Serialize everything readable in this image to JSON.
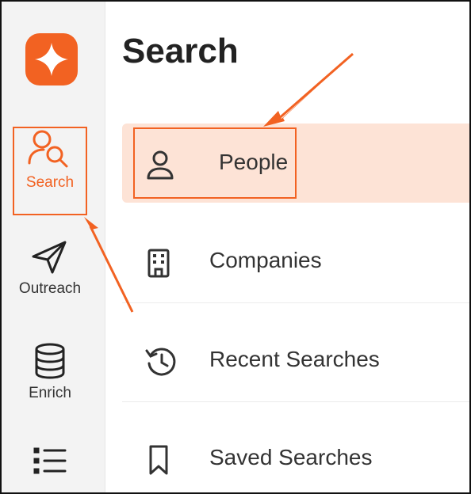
{
  "colors": {
    "accent": "#f26222",
    "active_row_bg": "#fde3d6",
    "sidebar_bg": "#f3f3f3"
  },
  "sidebar": {
    "logo_icon": "brand-logo-icon",
    "items": [
      {
        "label": "Search",
        "icon": "user-search-icon",
        "active": true
      },
      {
        "label": "Outreach",
        "icon": "paper-plane-icon",
        "active": false
      },
      {
        "label": "Enrich",
        "icon": "database-icon",
        "active": false
      },
      {
        "label": "",
        "icon": "list-icon",
        "active": false
      }
    ]
  },
  "main": {
    "title": "Search",
    "menu": [
      {
        "label": "People",
        "icon": "person-icon",
        "active": true
      },
      {
        "label": "Companies",
        "icon": "building-icon",
        "active": false
      },
      {
        "label": "Recent Searches",
        "icon": "history-icon",
        "active": false
      },
      {
        "label": "Saved Searches",
        "icon": "bookmark-icon",
        "active": false
      }
    ]
  }
}
